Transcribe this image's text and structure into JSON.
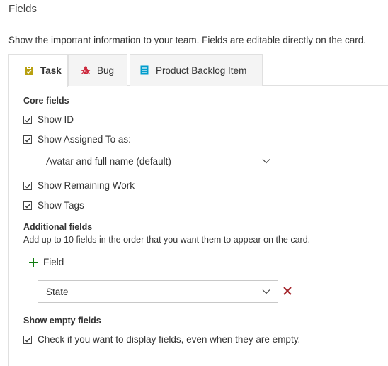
{
  "page": {
    "title": "Fields",
    "description": "Show the important information to your team. Fields are editable directly on the card."
  },
  "tabs": [
    {
      "label": "Task",
      "icon": "task-icon",
      "active": true
    },
    {
      "label": "Bug",
      "icon": "bug-icon",
      "active": false
    },
    {
      "label": "Product Backlog Item",
      "icon": "backlog-item-icon",
      "active": false
    }
  ],
  "core_fields": {
    "title": "Core fields",
    "show_id": {
      "label": "Show ID",
      "checked": true
    },
    "show_assigned": {
      "label": "Show Assigned To as:",
      "checked": true
    },
    "assigned_select": {
      "value": "Avatar and full name (default)"
    },
    "show_remaining": {
      "label": "Show Remaining Work",
      "checked": true
    },
    "show_tags": {
      "label": "Show Tags",
      "checked": true
    }
  },
  "additional_fields": {
    "title": "Additional fields",
    "hint": "Add up to 10 fields in the order that you want them to appear on the card.",
    "add_label": "Field",
    "fields": [
      {
        "value": "State"
      }
    ]
  },
  "empty_fields": {
    "title": "Show empty fields",
    "checkbox": {
      "label": "Check if you want to display fields, even when they are empty.",
      "checked": true
    }
  },
  "colors": {
    "task_icon": "#b8a010",
    "bug_icon": "#cc293d",
    "backlog_icon": "#009ccc",
    "add_icon": "#107c10",
    "remove_icon": "#a4262c"
  }
}
